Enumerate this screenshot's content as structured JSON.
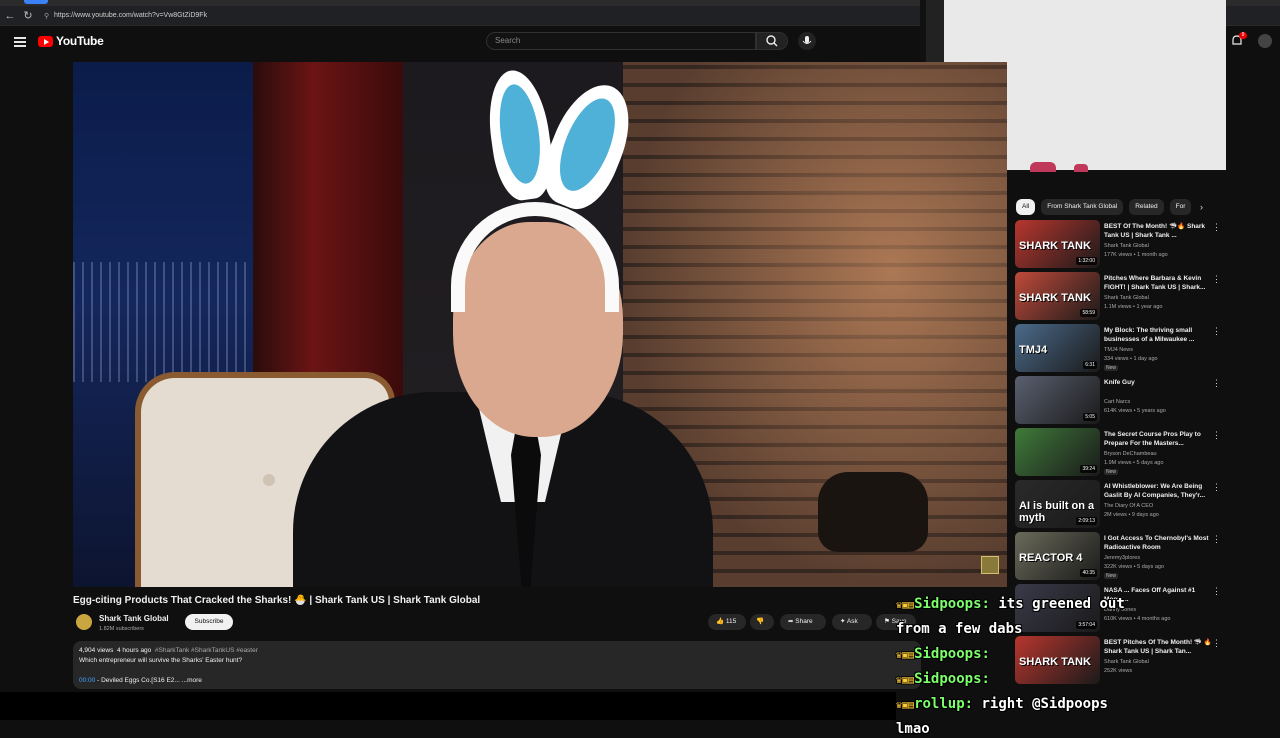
{
  "browser": {
    "url": "https://www.youtube.com/watch?v=Vw8GtZiD9Fk"
  },
  "header": {
    "logo_text": "YouTube",
    "search_placeholder": "Search",
    "notification_count": "9"
  },
  "video": {
    "title": "Egg-citing Products That Cracked the Sharks! 🐣 | Shark Tank US | Shark Tank Global",
    "channel": "Shark Tank Global",
    "subscribers": "1.82M subscribers",
    "subscribe_label": "Subscribe",
    "likes": "115",
    "share_label": "Share",
    "ask_label": "Ask",
    "save_label": "Save",
    "download_label": "Download"
  },
  "description": {
    "views": "4,904 views",
    "age": "4 hours ago",
    "tags": "#SharkTank #SharkTankUS #easter",
    "body": "Which entrepreneur will survive the Sharks' Easter hunt?",
    "chapter_time": "00:00",
    "chapter_title": "- Deviled Eggs Co.[S16 E2...",
    "more_label": "...more"
  },
  "chips": [
    "All",
    "From Shark Tank Global",
    "Related",
    "For"
  ],
  "recommendations": [
    {
      "title": "BEST Of The Month! 🦈🔥 Shark Tank US | Shark Tank ...",
      "channel": "Shark Tank Global",
      "meta": "177K views • 1 month ago",
      "duration": "1:32:00",
      "thumb_label": "SHARK TANK",
      "thumb_color": "#b8362e",
      "new": ""
    },
    {
      "title": "Pitches Where Barbara & Kevin FIGHT! | Shark Tank US | Shark...",
      "channel": "Shark Tank Global",
      "meta": "1.1M views • 1 year ago",
      "duration": "58:59",
      "thumb_label": "SHARK TANK",
      "thumb_color": "#c04a3a",
      "new": ""
    },
    {
      "title": "My Block: The thriving small businesses of a Milwaukee ...",
      "channel": "TMJ4 News",
      "meta": "334 views • 1 day ago",
      "duration": "6:31",
      "thumb_label": "TMJ4",
      "thumb_color": "#4b6a8a",
      "new": "New"
    },
    {
      "title": "Knife Guy",
      "channel": "Cart Narcs",
      "meta": "614K views • 5 years ago",
      "duration": "5:05",
      "thumb_label": "",
      "thumb_color": "#5a6070",
      "new": ""
    },
    {
      "title": "The Secret Course Pros Play to Prepare For the Masters...",
      "channel": "Bryson DeChambeau",
      "meta": "1.9M views • 5 days ago",
      "duration": "39:24",
      "thumb_label": "",
      "thumb_color": "#3f7a3a",
      "new": "New"
    },
    {
      "title": "AI Whistleblower: We Are Being Gaslit By AI Companies, They'r...",
      "channel": "The Diary Of A CEO",
      "meta": "2M views • 9 days ago",
      "duration": "2:09:13",
      "thumb_label": "AI is built on a myth",
      "thumb_color": "#2a2a2a",
      "new": ""
    },
    {
      "title": "I Got Access To Chernobyl's Most Radioactive Room",
      "channel": "Jeremy3plores",
      "meta": "322K views • 5 days ago",
      "duration": "40:35",
      "thumb_label": "REACTOR 4",
      "thumb_color": "#6a6a5a",
      "new": "New"
    },
    {
      "title": "NASA ... Faces Off Against #1 Moon ...",
      "channel": "Danny Jones",
      "meta": "610K views • 4 months ago",
      "duration": "3:57:04",
      "thumb_label": "",
      "thumb_color": "#3a3a4a",
      "new": ""
    },
    {
      "title": "BEST Pitches Of The Month! 🦈 🔥 Shark Tank US | Shark Tan...",
      "channel": "Shark Tank Global",
      "meta": "252K views",
      "duration": "",
      "thumb_label": "SHARK TANK",
      "thumb_color": "#b8362e",
      "new": ""
    }
  ],
  "chat": [
    {
      "badges": "♛▣▤",
      "user": "Sidpoops:",
      "msg": " its greened out"
    },
    {
      "badges": "",
      "user": "",
      "msg": "from a few dabs"
    },
    {
      "badges": "♛▣▤",
      "user": "Sidpoops:",
      "msg": ""
    },
    {
      "badges": "♛▣▤",
      "user": "Sidpoops:",
      "msg": ""
    },
    {
      "badges": "♛▣▤",
      "user": "rollup:",
      "msg": " right @Sidpoops"
    },
    {
      "badges": "",
      "user": "",
      "msg": "lmao"
    }
  ]
}
